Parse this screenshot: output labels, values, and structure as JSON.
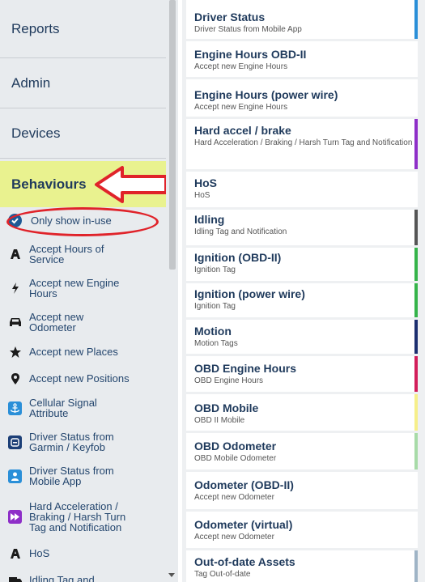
{
  "sidebar": {
    "nav": {
      "reports": "Reports",
      "admin": "Admin",
      "devices": "Devices",
      "behaviours": "Behaviours"
    },
    "filter_label": "Only show in-use",
    "rules": [
      {
        "label_lines": [
          "Accept Hours of",
          "Service"
        ],
        "icon": "hos-icon"
      },
      {
        "label_lines": [
          "Accept new Engine",
          "Hours"
        ],
        "icon": "bolt-icon"
      },
      {
        "label_lines": [
          "Accept new",
          "Odometer"
        ],
        "icon": "car-icon"
      },
      {
        "label_lines": [
          "Accept new Places"
        ],
        "icon": "star-icon"
      },
      {
        "label_lines": [
          "Accept new Positions"
        ],
        "icon": "pin-icon"
      },
      {
        "label_lines": [
          "Cellular Signal",
          "Attribute"
        ],
        "icon": "anchor-icon"
      },
      {
        "label_lines": [
          "Driver Status from",
          "Garmin / Keyfob"
        ],
        "icon": "garmin-icon"
      },
      {
        "label_lines": [
          "Driver Status from",
          "Mobile App"
        ],
        "icon": "person-icon"
      },
      {
        "label_lines": [
          "Hard Acceleration /",
          "Braking / Harsh Turn",
          "Tag and Notification"
        ],
        "icon": "fast-forward-icon"
      },
      {
        "label_lines": [
          "HoS"
        ],
        "icon": "hos-icon"
      },
      {
        "label_lines": [
          "Idling Tag and"
        ],
        "icon": "truck-icon"
      }
    ]
  },
  "rules_panel": {
    "entries": [
      {
        "title": "Driver Status",
        "subtitle": "Driver Status from Mobile App",
        "accent": "#2a8fd8"
      },
      {
        "title": "Engine Hours OBD-II",
        "subtitle": "Accept new Engine Hours",
        "accent": ""
      },
      {
        "title": "Engine Hours (power wire)",
        "subtitle": "Accept new Engine Hours",
        "accent": ""
      },
      {
        "title": "Hard accel / brake",
        "subtitle": "Hard Acceleration / Braking / Harsh Turn Tag and Notification",
        "accent": "#8e2fc8"
      },
      {
        "title": "HoS",
        "subtitle": "HoS",
        "accent": ""
      },
      {
        "title": "Idling",
        "subtitle": "Idling Tag and Notification",
        "accent": "#555555"
      },
      {
        "title": "Ignition (OBD-II)",
        "subtitle": "Ignition Tag",
        "accent": "#35b44a"
      },
      {
        "title": "Ignition (power wire)",
        "subtitle": "Ignition Tag",
        "accent": "#35b44a"
      },
      {
        "title": "Motion",
        "subtitle": "Motion Tags",
        "accent": "#1c2f70"
      },
      {
        "title": "OBD Engine Hours",
        "subtitle": "OBD Engine Hours",
        "accent": "#d21e5a"
      },
      {
        "title": "OBD Mobile",
        "subtitle": "OBD II Mobile",
        "accent": "#f6ef8a"
      },
      {
        "title": "OBD Odometer",
        "subtitle": "OBD Mobile Odometer",
        "accent": "#a8dba8"
      },
      {
        "title": "Odometer (OBD-II)",
        "subtitle": "Accept new Odometer",
        "accent": ""
      },
      {
        "title": "Odometer (virtual)",
        "subtitle": "Accept new Odometer",
        "accent": ""
      },
      {
        "title": "Out-of-date Assets",
        "subtitle": "Tag Out-of-date",
        "accent": "#9fb4c6"
      }
    ]
  },
  "annotation_color": "#e0232a"
}
